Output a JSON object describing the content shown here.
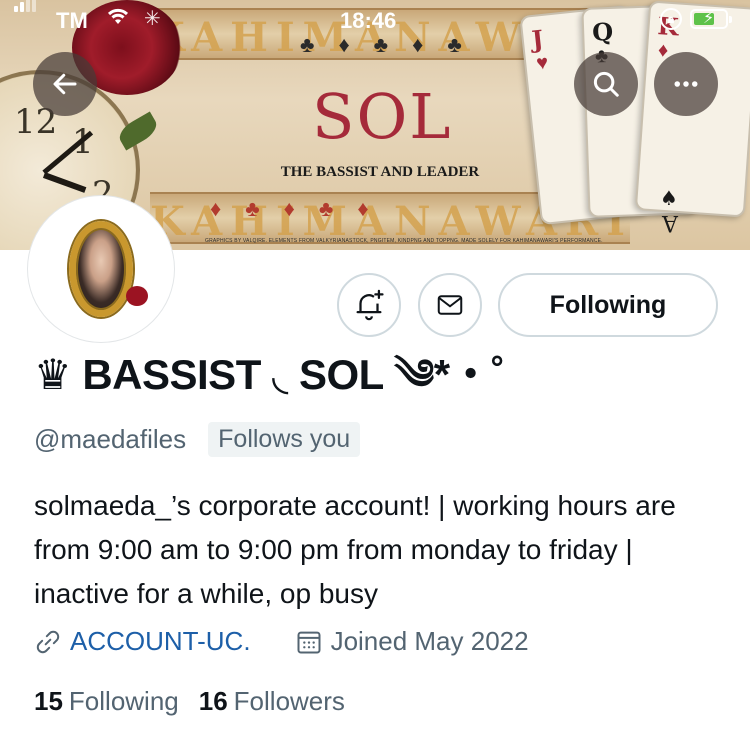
{
  "status_bar": {
    "carrier": "TM",
    "time": "18:46"
  },
  "banner": {
    "band_text_top": "KAHIMANAWARI",
    "band_text_bottom": "KAHIMANAWARI",
    "title": "SOL",
    "subtitle": "THE BASSIST AND LEADER",
    "credits": "GRAPHICS BY VALQIRE. ELEMENTS FROM VALKYRIANASTOCK, PNGITEM, KINDPNG AND TOPPNG. MADE SOLELY FOR KAHIMANAWARI'S PERFORMANCE.",
    "card_ranks": [
      "J",
      "Q",
      "K"
    ],
    "ace_rank": "A"
  },
  "nav": {
    "back_icon": "arrow-left-icon",
    "search_icon": "search-icon",
    "more_icon": "more-horizontal-icon"
  },
  "actions": {
    "notify_icon": "bell-plus-icon",
    "message_icon": "envelope-icon",
    "follow_label": "Following"
  },
  "profile": {
    "display_name": "♛ BASSIST ◟ SOL ༄*・˚",
    "handle": "@maedafiles",
    "follows_you": "Follows you",
    "bio": "solmaeda_’s corporate account! | working hours are from 9:00 am to 9:00 pm from monday to friday | inactive for a while, op busy",
    "link_text": "ACCOUNT-UC.",
    "joined_text": "Joined May 2022",
    "following_count": "15",
    "following_label": "Following",
    "followers_count": "16",
    "followers_label": "Followers"
  },
  "colors": {
    "link": "#1d5fa8",
    "secondary_text": "#536471",
    "border": "#cfd9de",
    "battery": "#5ec24a"
  }
}
